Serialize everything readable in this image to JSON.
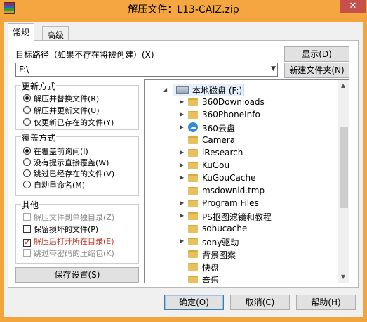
{
  "window": {
    "title": "解压文件：L13-CAIZ.zip",
    "close_glyph": "✕",
    "accent": "#f5a640"
  },
  "tabs": [
    {
      "label": "常规",
      "active": true
    },
    {
      "label": "高级",
      "active": false
    }
  ],
  "target": {
    "label": "目标路径（如果不存在将被创建）(X)",
    "value": "F:\\",
    "show_button": "显示(D)",
    "new_folder_button": "新建文件夹(N)"
  },
  "update_group": {
    "title": "更新方式",
    "options": [
      {
        "label": "解压并替换文件(R)",
        "selected": true
      },
      {
        "label": "解压并更新文件(U)",
        "selected": false
      },
      {
        "label": "仅更新已存在的文件(Y)",
        "selected": false
      }
    ]
  },
  "overwrite_group": {
    "title": "覆盖方式",
    "options": [
      {
        "label": "在覆盖前询问(I)",
        "selected": true
      },
      {
        "label": "没有提示直接覆盖(W)",
        "selected": false
      },
      {
        "label": "跳过已经存在的文件(V)",
        "selected": false
      },
      {
        "label": "自动重命名(M)",
        "selected": false
      }
    ]
  },
  "other_group": {
    "title": "其他",
    "options": [
      {
        "label": "解压文件到单独目录(Z)",
        "checked": false,
        "disabled": true
      },
      {
        "label": "保留损坏的文件(P)",
        "checked": false,
        "disabled": false
      },
      {
        "label": "解压后打开所在目录(E)",
        "checked": true,
        "disabled": false
      },
      {
        "label": "跳过带密码的压缩包(K)",
        "checked": false,
        "disabled": true
      }
    ]
  },
  "save_settings_button": "保存设置(S)",
  "tree": {
    "root": "本地磁盘 (F:)",
    "items": [
      {
        "label": "360Downloads",
        "expandable": true,
        "icon": "folder-icon"
      },
      {
        "label": "360PhoneInfo",
        "expandable": true,
        "icon": "folder-icon"
      },
      {
        "label": "360云盘",
        "expandable": true,
        "icon": "cloud-icon"
      },
      {
        "label": "Camera",
        "expandable": false,
        "icon": "folder-icon"
      },
      {
        "label": "iResearch",
        "expandable": true,
        "icon": "folder-icon"
      },
      {
        "label": "KuGou",
        "expandable": true,
        "icon": "folder-icon"
      },
      {
        "label": "KuGouCache",
        "expandable": true,
        "icon": "folder-icon"
      },
      {
        "label": "msdownld.tmp",
        "expandable": false,
        "icon": "folder-icon"
      },
      {
        "label": "Program Files",
        "expandable": true,
        "icon": "folder-icon"
      },
      {
        "label": "PS抠图滤镜和教程",
        "expandable": true,
        "icon": "folder-icon"
      },
      {
        "label": "sohucache",
        "expandable": false,
        "icon": "folder-icon"
      },
      {
        "label": "sony驱动",
        "expandable": true,
        "icon": "folder-icon"
      },
      {
        "label": "背景图案",
        "expandable": false,
        "icon": "folder-icon"
      },
      {
        "label": "快盘",
        "expandable": false,
        "icon": "folder-icon"
      },
      {
        "label": "音乐",
        "expandable": false,
        "icon": "folder-icon"
      }
    ]
  },
  "footer": {
    "ok": "确定(O)",
    "cancel": "取消(C)",
    "help": "帮助(H)"
  }
}
